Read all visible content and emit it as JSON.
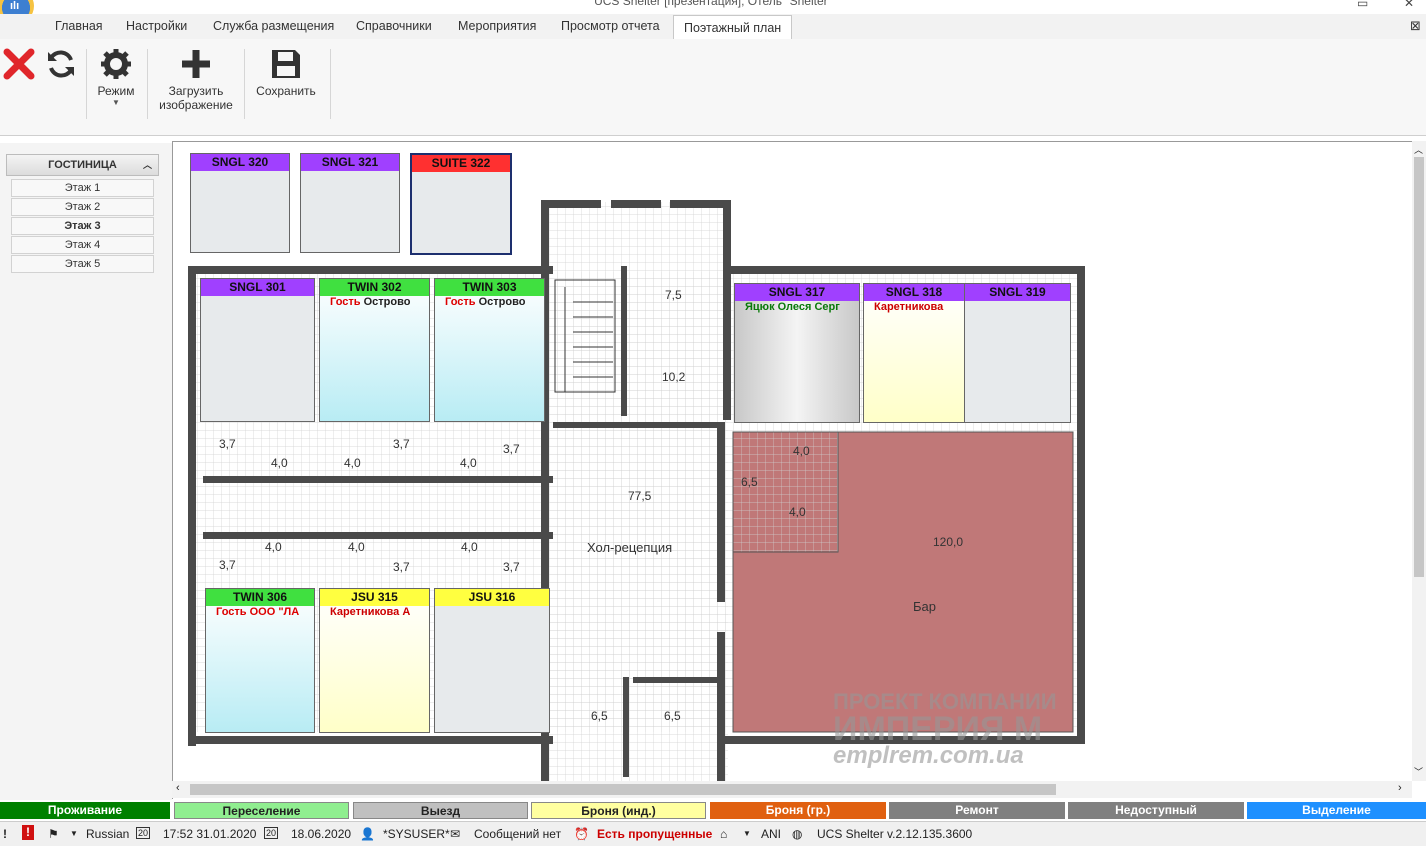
{
  "window": {
    "title": "UCS Shelter [презентация], Отель \"Shelter\""
  },
  "tabs": [
    "Главная",
    "Настройки",
    "Служба размещения",
    "Справочники",
    "Мероприятия",
    "Просмотр отчета",
    "Поэтажный план"
  ],
  "ribbon": {
    "mode": "Режим",
    "upload_line1": "Загрузить",
    "upload_line2": "изображение",
    "save": "Сохранить"
  },
  "sidebar": {
    "title": "ГОСТИНИЦА",
    "floors": [
      "Этаж 1",
      "Этаж 2",
      "Этаж 3",
      "Этаж 4",
      "Этаж 5"
    ],
    "selected": "Этаж 3"
  },
  "rooms": {
    "r320": {
      "name": "SNGL 320"
    },
    "r321": {
      "name": "SNGL 321"
    },
    "r322": {
      "name": "SUITE 322"
    },
    "r301": {
      "name": "SNGL 301"
    },
    "r302": {
      "name": "TWIN 302",
      "guest_prefix": "Гость",
      "guest": "Острово"
    },
    "r303": {
      "name": "TWIN 303",
      "guest_prefix": "Гость",
      "guest": "Острово"
    },
    "r317": {
      "name": "SNGL 317",
      "guest": "Яцюк Олеся Серг"
    },
    "r318": {
      "name": "SNGL 318",
      "guest": "Каретникова"
    },
    "r319": {
      "name": "SNGL 319"
    },
    "r306": {
      "name": "TWIN 306",
      "guest_prefix": "Гость",
      "guest": "ООО \"ЛА"
    },
    "r315": {
      "name": "JSU 315",
      "guest": "Каретникова А"
    },
    "r316": {
      "name": "JSU 316"
    }
  },
  "plan_labels": [
    "7,5",
    "10,2",
    "77,5",
    "Хол-рецепция",
    "120,0",
    "Бар",
    "4,0",
    "4,0",
    "6,5",
    "3,7",
    "4,0",
    "4,0",
    "3,7",
    "4,0",
    "3,7",
    "3,7",
    "4,0",
    "4,0",
    "3,7",
    "4,0",
    "3,7",
    "6,5",
    "6,5"
  ],
  "watermark": {
    "line1": "ПРОЕКТ КОМПАНИИ",
    "line2": "ИМПЕРИЯ М",
    "line3": "emplrem.com.ua"
  },
  "legend": [
    "Проживание",
    "Переселение",
    "Выезд",
    "Броня (инд.)",
    "Броня (гр.)",
    "Ремонт",
    "Недоступный",
    "Выделение"
  ],
  "colors": {
    "living": "#008000",
    "moving": "#90ee90",
    "checkout": "#c0c0c0",
    "book_ind": "#ffffa0",
    "book_grp": "#e06010",
    "repair": "#808080",
    "unavailable": "#808080",
    "selection": "#1e90ff",
    "sngl": "#a040ff",
    "twin": "#40e040",
    "jsu": "#ffff40",
    "suite": "#ff3030",
    "bar": "#c07878"
  },
  "status": {
    "lang": "Russian",
    "time": "17:52  31.01.2020",
    "date": "18.06.2020",
    "user": "*SYSUSER*",
    "messages": "Сообщений нет",
    "missed": "Есть пропущенные",
    "ani": "ANI",
    "version": "UCS Shelter v.2.12.135.3600",
    "cal1": "20",
    "cal2": "20"
  }
}
